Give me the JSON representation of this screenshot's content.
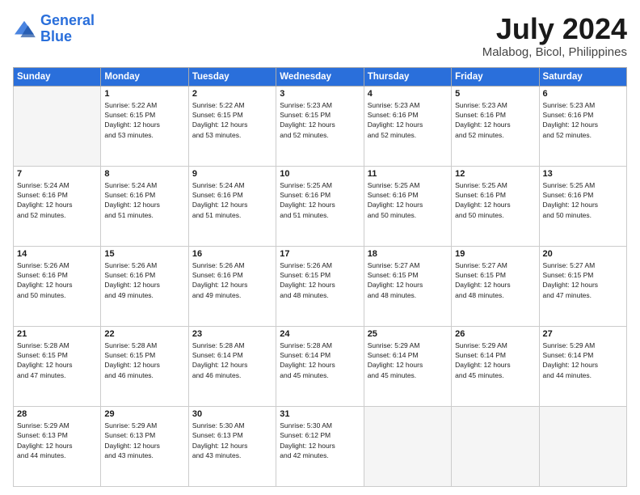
{
  "logo": {
    "line1": "General",
    "line2": "Blue"
  },
  "title": "July 2024",
  "subtitle": "Malabog, Bicol, Philippines",
  "weekdays": [
    "Sunday",
    "Monday",
    "Tuesday",
    "Wednesday",
    "Thursday",
    "Friday",
    "Saturday"
  ],
  "weeks": [
    [
      {
        "day": "",
        "info": ""
      },
      {
        "day": "1",
        "info": "Sunrise: 5:22 AM\nSunset: 6:15 PM\nDaylight: 12 hours\nand 53 minutes."
      },
      {
        "day": "2",
        "info": "Sunrise: 5:22 AM\nSunset: 6:15 PM\nDaylight: 12 hours\nand 53 minutes."
      },
      {
        "day": "3",
        "info": "Sunrise: 5:23 AM\nSunset: 6:15 PM\nDaylight: 12 hours\nand 52 minutes."
      },
      {
        "day": "4",
        "info": "Sunrise: 5:23 AM\nSunset: 6:16 PM\nDaylight: 12 hours\nand 52 minutes."
      },
      {
        "day": "5",
        "info": "Sunrise: 5:23 AM\nSunset: 6:16 PM\nDaylight: 12 hours\nand 52 minutes."
      },
      {
        "day": "6",
        "info": "Sunrise: 5:23 AM\nSunset: 6:16 PM\nDaylight: 12 hours\nand 52 minutes."
      }
    ],
    [
      {
        "day": "7",
        "info": "Sunrise: 5:24 AM\nSunset: 6:16 PM\nDaylight: 12 hours\nand 52 minutes."
      },
      {
        "day": "8",
        "info": "Sunrise: 5:24 AM\nSunset: 6:16 PM\nDaylight: 12 hours\nand 51 minutes."
      },
      {
        "day": "9",
        "info": "Sunrise: 5:24 AM\nSunset: 6:16 PM\nDaylight: 12 hours\nand 51 minutes."
      },
      {
        "day": "10",
        "info": "Sunrise: 5:25 AM\nSunset: 6:16 PM\nDaylight: 12 hours\nand 51 minutes."
      },
      {
        "day": "11",
        "info": "Sunrise: 5:25 AM\nSunset: 6:16 PM\nDaylight: 12 hours\nand 50 minutes."
      },
      {
        "day": "12",
        "info": "Sunrise: 5:25 AM\nSunset: 6:16 PM\nDaylight: 12 hours\nand 50 minutes."
      },
      {
        "day": "13",
        "info": "Sunrise: 5:25 AM\nSunset: 6:16 PM\nDaylight: 12 hours\nand 50 minutes."
      }
    ],
    [
      {
        "day": "14",
        "info": "Sunrise: 5:26 AM\nSunset: 6:16 PM\nDaylight: 12 hours\nand 50 minutes."
      },
      {
        "day": "15",
        "info": "Sunrise: 5:26 AM\nSunset: 6:16 PM\nDaylight: 12 hours\nand 49 minutes."
      },
      {
        "day": "16",
        "info": "Sunrise: 5:26 AM\nSunset: 6:16 PM\nDaylight: 12 hours\nand 49 minutes."
      },
      {
        "day": "17",
        "info": "Sunrise: 5:26 AM\nSunset: 6:15 PM\nDaylight: 12 hours\nand 48 minutes."
      },
      {
        "day": "18",
        "info": "Sunrise: 5:27 AM\nSunset: 6:15 PM\nDaylight: 12 hours\nand 48 minutes."
      },
      {
        "day": "19",
        "info": "Sunrise: 5:27 AM\nSunset: 6:15 PM\nDaylight: 12 hours\nand 48 minutes."
      },
      {
        "day": "20",
        "info": "Sunrise: 5:27 AM\nSunset: 6:15 PM\nDaylight: 12 hours\nand 47 minutes."
      }
    ],
    [
      {
        "day": "21",
        "info": "Sunrise: 5:28 AM\nSunset: 6:15 PM\nDaylight: 12 hours\nand 47 minutes."
      },
      {
        "day": "22",
        "info": "Sunrise: 5:28 AM\nSunset: 6:15 PM\nDaylight: 12 hours\nand 46 minutes."
      },
      {
        "day": "23",
        "info": "Sunrise: 5:28 AM\nSunset: 6:14 PM\nDaylight: 12 hours\nand 46 minutes."
      },
      {
        "day": "24",
        "info": "Sunrise: 5:28 AM\nSunset: 6:14 PM\nDaylight: 12 hours\nand 45 minutes."
      },
      {
        "day": "25",
        "info": "Sunrise: 5:29 AM\nSunset: 6:14 PM\nDaylight: 12 hours\nand 45 minutes."
      },
      {
        "day": "26",
        "info": "Sunrise: 5:29 AM\nSunset: 6:14 PM\nDaylight: 12 hours\nand 45 minutes."
      },
      {
        "day": "27",
        "info": "Sunrise: 5:29 AM\nSunset: 6:14 PM\nDaylight: 12 hours\nand 44 minutes."
      }
    ],
    [
      {
        "day": "28",
        "info": "Sunrise: 5:29 AM\nSunset: 6:13 PM\nDaylight: 12 hours\nand 44 minutes."
      },
      {
        "day": "29",
        "info": "Sunrise: 5:29 AM\nSunset: 6:13 PM\nDaylight: 12 hours\nand 43 minutes."
      },
      {
        "day": "30",
        "info": "Sunrise: 5:30 AM\nSunset: 6:13 PM\nDaylight: 12 hours\nand 43 minutes."
      },
      {
        "day": "31",
        "info": "Sunrise: 5:30 AM\nSunset: 6:12 PM\nDaylight: 12 hours\nand 42 minutes."
      },
      {
        "day": "",
        "info": ""
      },
      {
        "day": "",
        "info": ""
      },
      {
        "day": "",
        "info": ""
      }
    ]
  ]
}
